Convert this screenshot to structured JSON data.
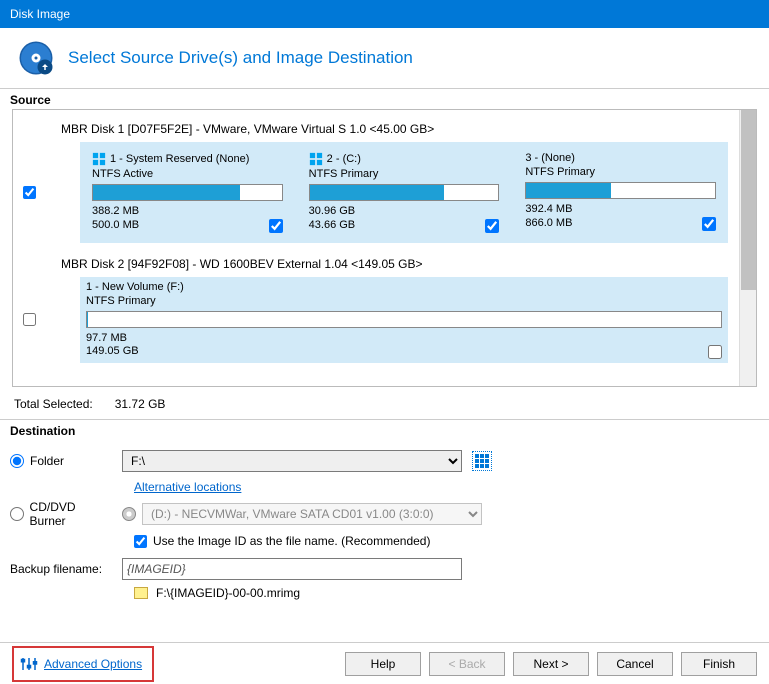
{
  "window_title": "Disk Image",
  "header_title": "Select Source Drive(s) and Image Destination",
  "section_source": "Source",
  "disk1": {
    "title": "MBR Disk 1 [D07F5F2E] - VMware,  VMware Virtual S 1.0  <45.00 GB>",
    "checked": true,
    "partitions": [
      {
        "label": "1 - System Reserved (None)",
        "type": "NTFS Active",
        "used": "388.2 MB",
        "total": "500.0 MB",
        "fill": 78,
        "checked": true,
        "winflag": true
      },
      {
        "label": "2 -  (C:)",
        "type": "NTFS Primary",
        "used": "30.96 GB",
        "total": "43.66 GB",
        "fill": 71,
        "checked": true,
        "winflag": true
      },
      {
        "label": "3 -  (None)",
        "type": "NTFS Primary",
        "used": "392.4 MB",
        "total": "866.0 MB",
        "fill": 45,
        "checked": true,
        "winflag": false
      }
    ]
  },
  "disk2": {
    "title": "MBR Disk 2 [94F92F08] - WD       1600BEV External 1.04  <149.05 GB>",
    "checked": false,
    "partition": {
      "label": "1 - New Volume (F:)",
      "type": "NTFS Primary",
      "used": "97.7 MB",
      "total": "149.05 GB",
      "fill": 0,
      "checked": false
    }
  },
  "total_label": "Total Selected:",
  "total_value": "31.72 GB",
  "section_dest": "Destination",
  "dest": {
    "folder_label": "Folder",
    "folder_value": "F:\\",
    "alt_locations": "Alternative locations",
    "burner_label": "CD/DVD Burner",
    "burner_value": "(D:) - NECVMWar, VMware SATA CD01 v1.00 (3:0:0)",
    "use_image_id": "Use the Image ID as the file name.  (Recommended)",
    "filename_label": "Backup filename:",
    "filename_value": "{IMAGEID}",
    "preview": "F:\\{IMAGEID}-00-00.mrimg"
  },
  "advanced_options": "Advanced Options",
  "buttons": {
    "help": "Help",
    "back": "< Back",
    "next": "Next >",
    "cancel": "Cancel",
    "finish": "Finish"
  }
}
